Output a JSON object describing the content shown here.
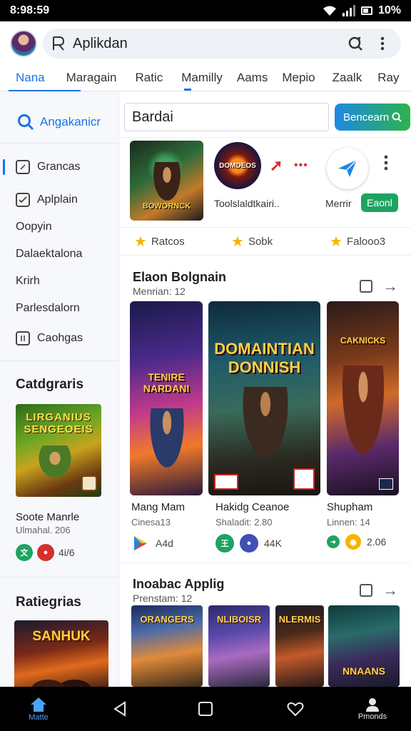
{
  "status_bar": {
    "time": "8:98:59",
    "battery_text": "10%"
  },
  "header": {
    "title": "Aplikdan"
  },
  "tabs": [
    {
      "label": "Nana",
      "active": true
    },
    {
      "label": "Maragain",
      "active": false
    },
    {
      "label": "Ratic",
      "active": false
    },
    {
      "label": "Mamilly",
      "active": false
    },
    {
      "label": "Aams",
      "active": false
    },
    {
      "label": "Mepio",
      "active": false
    },
    {
      "label": "Zaalk",
      "active": false
    },
    {
      "label": "Ray",
      "active": false
    }
  ],
  "sidebar": {
    "search_label": "Angakanicr",
    "items": [
      {
        "label": "Grancas",
        "icon": "box-icon",
        "active": true
      },
      {
        "label": "Aplplain",
        "icon": "check-box-icon",
        "active": false
      },
      {
        "label": "Oopyin",
        "icon": "",
        "active": false
      },
      {
        "label": "Dalaektalona",
        "icon": "",
        "active": false
      },
      {
        "label": "Krirh",
        "icon": "",
        "active": false
      },
      {
        "label": "Parlesdalorn",
        "icon": "",
        "active": false
      },
      {
        "label": "Caohgas",
        "icon": "grid-box-icon",
        "active": false
      }
    ],
    "categories_heading": "Catdgraris",
    "category_card": {
      "art_text": "LIRGANIUS SENGEOEIS",
      "name": "Soote Manrle",
      "subtitle": "Ulmahal. 206",
      "rating": "4i/6"
    },
    "ratings_heading": "Ratiegrias",
    "rating_card": {
      "art_text": "SANHUK"
    }
  },
  "main": {
    "search": {
      "value": "Bardai",
      "button_label": "Bencearn"
    },
    "featured": {
      "thumb_art": "BOWORNCK",
      "logo_text": "DOMDEOS",
      "caption": "Toolslaldtkairi..",
      "label2": "Merrir",
      "get_button": "Eaonl"
    },
    "ratings_row": [
      {
        "label": "Ratcos"
      },
      {
        "label": "Sobk"
      },
      {
        "label": "Falooo3"
      }
    ],
    "section1": {
      "title": "Elaon Bolgnain",
      "subtitle": "Menrian: 12",
      "cards": [
        {
          "art_text": "TENIRE NARDANI",
          "name": "Mang Mam",
          "subtitle": "Cinesa13",
          "meta": "A4d"
        },
        {
          "art_text": "DOMAINTIAN DONNISH",
          "name": "Hakidg Ceanoe",
          "subtitle": "Shaladit: 2.80",
          "meta": "44K"
        },
        {
          "art_text": "CAKNICKS",
          "name": "Shupham",
          "subtitle": "Linnen: 14",
          "meta": "2.06"
        }
      ]
    },
    "section2": {
      "title": "Inoabac Applig",
      "subtitle": "Prenstam: 12",
      "cards": [
        {
          "art_text": "ORANGERS"
        },
        {
          "art_text": "NLIBOISR"
        },
        {
          "art_text": "NLERMIS"
        },
        {
          "art_text": "NNAANS"
        }
      ]
    }
  },
  "bottom_nav": {
    "home_label": "Matte",
    "profile_label": "Pmonds"
  }
}
